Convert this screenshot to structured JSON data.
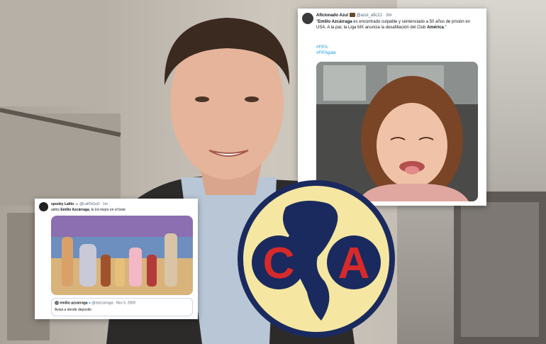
{
  "tweet_main": {
    "display_name": "Aficionado Azul",
    "handle": "@azul_afic21",
    "time": "3m",
    "text_bold_1": "Emilio Azcárraga",
    "text_1": " es encontrado culpable y sentenciado a 50 años de prisión en USA. A la par, la Liga MX anuncia la desafiliación del Club ",
    "text_bold_2": "América",
    "text_2": ".",
    "hashtag_1": "#FIFA",
    "hashtag_2": "#FIFAgate"
  },
  "tweet_reply": {
    "display_name": "spooky Lalito",
    "handle": "@LaliToGsO",
    "time": "1m",
    "text_prefix": "adiós ",
    "text_bold": "Emilio Azcárraga",
    "text_suffix": ", te irá mejor en el bote",
    "quoted_name": "emilio azcarraga",
    "quoted_handle": "@eazcarraga",
    "quoted_date": "Nov 5, 2009",
    "quoted_text": "Avisa a donde deposito"
  },
  "logo": {
    "letter_left": "C",
    "letter_right": "A",
    "colors": {
      "ring": "#1a2a5e",
      "fill": "#f5e7a1",
      "red": "#d62a2a"
    }
  }
}
